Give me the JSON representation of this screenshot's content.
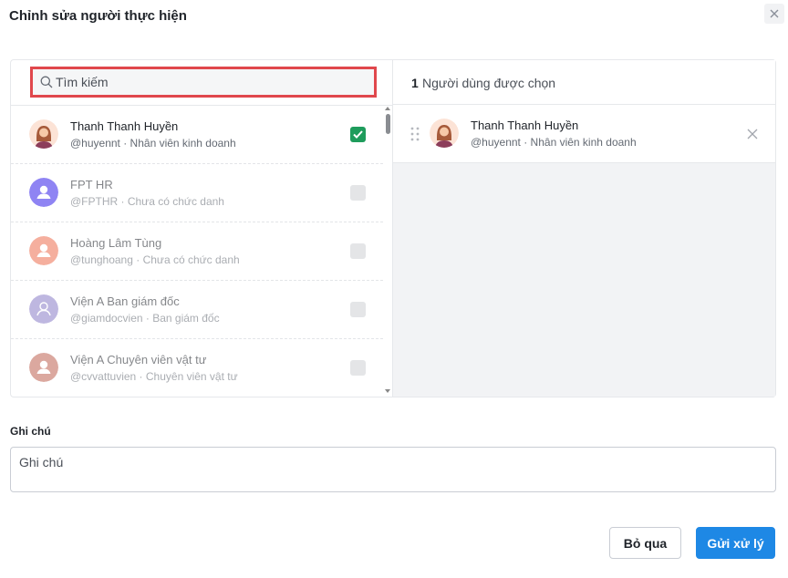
{
  "dialog": {
    "title": "Chỉnh sửa người thực hiện"
  },
  "search": {
    "placeholder": "Tìm kiếm"
  },
  "users": [
    {
      "name": "Thanh Thanh Huyền",
      "sub": "@huyennt · Nhân viên kinh doanh",
      "checked": true,
      "avatar": "woman-avatar-icon"
    },
    {
      "name": "FPT HR",
      "sub": "@FPTHR · Chưa có chức danh",
      "checked": false,
      "avatar": "user-avatar-icon",
      "color": "#6a5cf0"
    },
    {
      "name": "Hoàng Lâm Tùng",
      "sub": "@tunghoang · Chưa có chức danh",
      "checked": false,
      "avatar": "user-avatar-icon",
      "color": "#f2957e"
    },
    {
      "name": "Viện A Ban giám đốc",
      "sub": "@giamdocvien · Ban giám đốc",
      "checked": false,
      "avatar": "user-outline-avatar-icon",
      "color": "#a99fd6"
    },
    {
      "name": "Viện A Chuyên viên vật tư",
      "sub": "@cvvattuvien · Chuyên viên vật tư",
      "checked": false,
      "avatar": "user-avatar-icon",
      "color": "#cf8c80"
    }
  ],
  "selected": {
    "count": "1",
    "label": "Người dùng được chọn",
    "items": [
      {
        "name": "Thanh Thanh Huyền",
        "sub": "@huyennt · Nhân viên kinh doanh",
        "avatar": "woman-avatar-icon"
      }
    ]
  },
  "note": {
    "label": "Ghi chú",
    "placeholder": "Ghi chú",
    "value": ""
  },
  "buttons": {
    "cancel": "Bỏ qua",
    "submit": "Gửi xử lý"
  },
  "colors": {
    "accent": "#1e88e5",
    "checked": "#1e9c5c",
    "highlight": "#e0474c"
  }
}
